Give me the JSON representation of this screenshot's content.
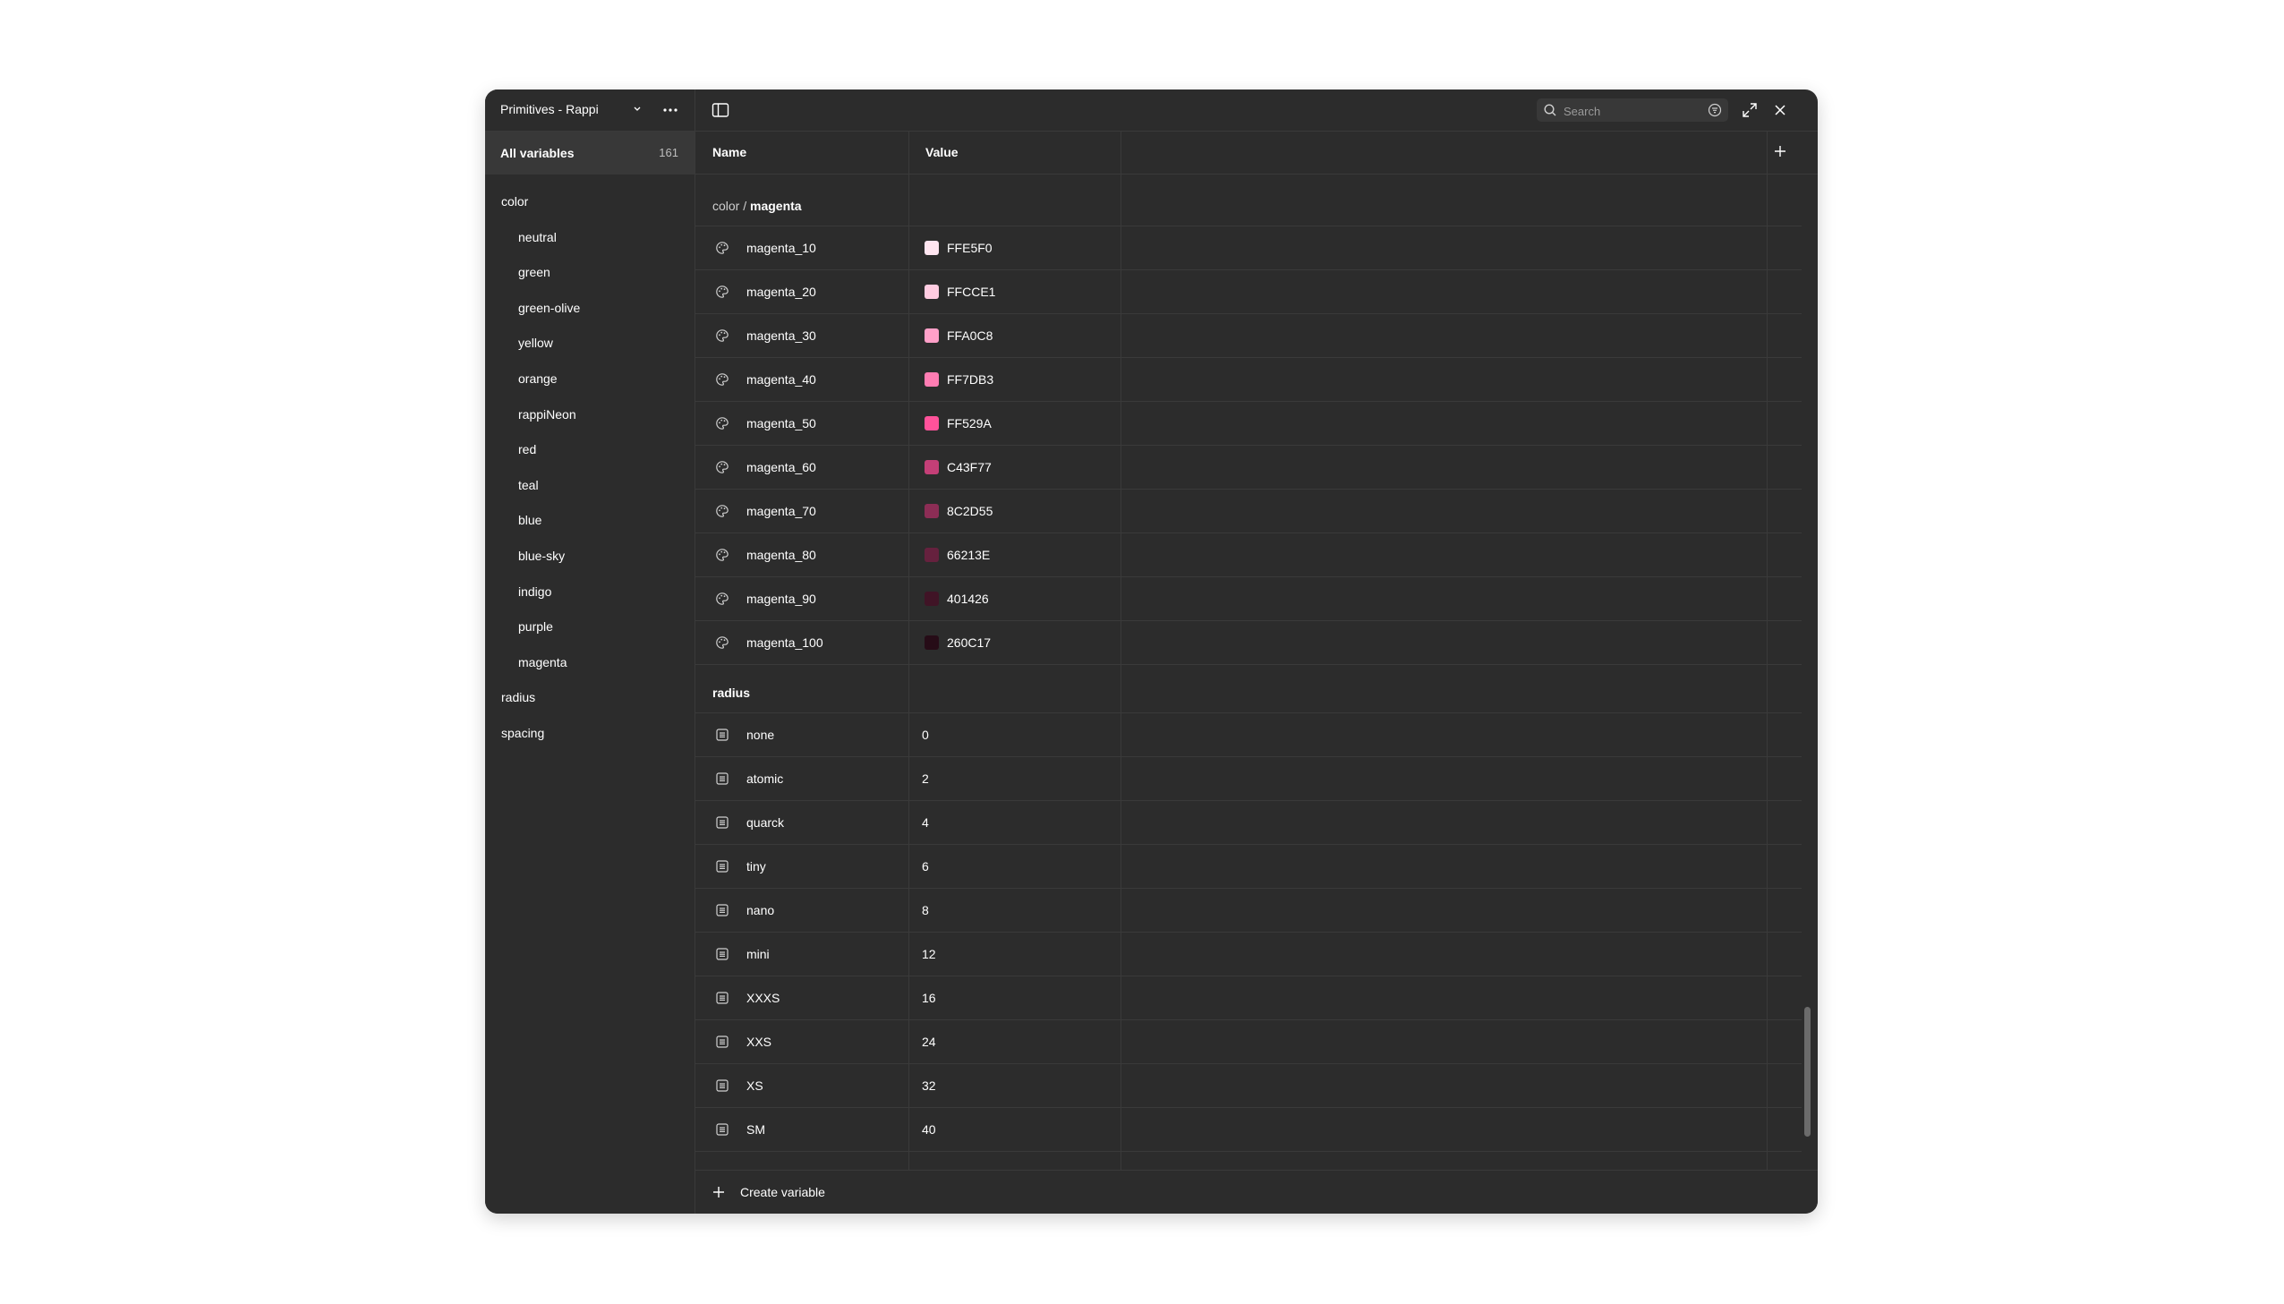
{
  "collection": {
    "name": "Primitives - Rappi"
  },
  "sidebar": {
    "all_variables_label": "All variables",
    "all_variables_count": "161",
    "groups": [
      {
        "label": "color",
        "indent": 0
      },
      {
        "label": "neutral",
        "indent": 1
      },
      {
        "label": "green",
        "indent": 1
      },
      {
        "label": "green-olive",
        "indent": 1
      },
      {
        "label": "yellow",
        "indent": 1
      },
      {
        "label": "orange",
        "indent": 1
      },
      {
        "label": "rappiNeon",
        "indent": 1
      },
      {
        "label": "red",
        "indent": 1
      },
      {
        "label": "teal",
        "indent": 1
      },
      {
        "label": "blue",
        "indent": 1
      },
      {
        "label": "blue-sky",
        "indent": 1
      },
      {
        "label": "indigo",
        "indent": 1
      },
      {
        "label": "purple",
        "indent": 1
      },
      {
        "label": "magenta",
        "indent": 1
      },
      {
        "label": "radius",
        "indent": 0
      },
      {
        "label": "spacing",
        "indent": 0
      }
    ]
  },
  "search": {
    "placeholder": "Search"
  },
  "table": {
    "columns": {
      "name": "Name",
      "value": "Value"
    }
  },
  "sections": {
    "magenta": {
      "prefix": "color / ",
      "title": "magenta",
      "rows": [
        {
          "name": "magenta_10",
          "value": "FFE5F0",
          "color": "#FFE5F0"
        },
        {
          "name": "magenta_20",
          "value": "FFCCE1",
          "color": "#FFCCE1"
        },
        {
          "name": "magenta_30",
          "value": "FFA0C8",
          "color": "#FFA0C8"
        },
        {
          "name": "magenta_40",
          "value": "FF7DB3",
          "color": "#FF7DB3"
        },
        {
          "name": "magenta_50",
          "value": "FF529A",
          "color": "#FF529A"
        },
        {
          "name": "magenta_60",
          "value": "C43F77",
          "color": "#C43F77"
        },
        {
          "name": "magenta_70",
          "value": "8C2D55",
          "color": "#8C2D55"
        },
        {
          "name": "magenta_80",
          "value": "66213E",
          "color": "#66213E"
        },
        {
          "name": "magenta_90",
          "value": "401426",
          "color": "#401426"
        },
        {
          "name": "magenta_100",
          "value": "260C17",
          "color": "#260C17"
        }
      ]
    },
    "radius": {
      "title": "radius",
      "rows": [
        {
          "name": "none",
          "value": "0"
        },
        {
          "name": "atomic",
          "value": "2"
        },
        {
          "name": "quarck",
          "value": "4"
        },
        {
          "name": "tiny",
          "value": "6"
        },
        {
          "name": "nano",
          "value": "8"
        },
        {
          "name": "mini",
          "value": "12"
        },
        {
          "name": "XXXS",
          "value": "16"
        },
        {
          "name": "XXS",
          "value": "24"
        },
        {
          "name": "XS",
          "value": "32"
        },
        {
          "name": "SM",
          "value": "40"
        }
      ]
    }
  },
  "footer": {
    "create_label": "Create variable"
  }
}
